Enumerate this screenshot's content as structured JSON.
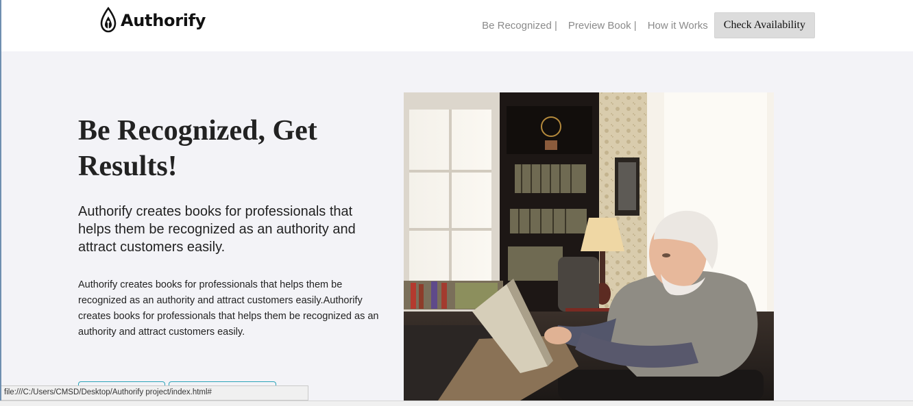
{
  "brand": {
    "name": "Authorify"
  },
  "nav": {
    "links": [
      "Be Recognized |",
      "Preview Book |",
      "How it Works"
    ],
    "cta_label": "Check Availability"
  },
  "hero": {
    "title": "Be Recognized, Get Results!",
    "lead": "Authorify creates books for professionals that helps them be recognized as an authority and attract customers easily.",
    "body": "Authorify creates books for professionals that helps them be recognized as an authority and attract customers easily.Authorify creates books for professionals that helps them be recognized as an authority and attract customers easily.",
    "image_icon": "photo-elderly-man-reading-book"
  },
  "statusbar": {
    "url": "file:///C:/Users/CMSD/Desktop/Authorify project/index.html#"
  },
  "colors": {
    "accent": "#2aa3b8",
    "header_bg": "#ffffff",
    "page_bg": "#f3f3f7",
    "cta_bg": "#dcdcdc"
  }
}
